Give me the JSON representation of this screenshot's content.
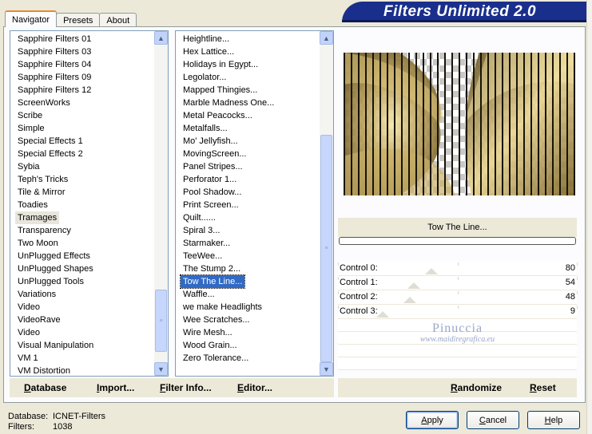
{
  "tabs": [
    {
      "label": "Navigator",
      "active": true
    },
    {
      "label": "Presets",
      "active": false
    },
    {
      "label": "About",
      "active": false
    }
  ],
  "banner": {
    "title": "Filters Unlimited 2.0"
  },
  "categories": {
    "items": [
      "Sapphire Filters 01",
      "Sapphire Filters 03",
      "Sapphire Filters 04",
      "Sapphire Filters 09",
      "Sapphire Filters 12",
      "ScreenWorks",
      "Scribe",
      "Simple",
      "Special Effects 1",
      "Special Effects 2",
      "Sybia",
      "Teph's Tricks",
      "Tile & Mirror",
      "Toadies",
      "Tramages",
      "Transparency",
      "Two Moon",
      "UnPlugged Effects",
      "UnPlugged Shapes",
      "UnPlugged Tools",
      "Variations",
      "Video",
      "VideoRave",
      "Video",
      "Visual Manipulation",
      "VM 1",
      "VM Distortion"
    ],
    "selected": "Tramages"
  },
  "filters": {
    "items": [
      "Heightline...",
      "Hex Lattice...",
      "Holidays in Egypt...",
      "Legolator...",
      "Mapped Thingies...",
      "Marble Madness One...",
      "Metal Peacocks...",
      "Metalfalls...",
      "Mo' Jellyfish...",
      "MovingScreen...",
      "Panel Stripes...",
      "Perforator 1...",
      "Pool Shadow...",
      "Print Screen...",
      "Quilt......",
      "Spiral 3...",
      "Starmaker...",
      "TeeWee...",
      "The Stump 2...",
      "Tow The Line...",
      "Waffle...",
      "we make Headlights",
      "Wee Scratches...",
      "Wire Mesh...",
      "Wood Grain...",
      "Zero Tolerance..."
    ],
    "selected": "Tow The Line..."
  },
  "preview": {
    "filter_name": "Tow The Line..."
  },
  "controls": [
    {
      "label": "Control 0:",
      "value": 80
    },
    {
      "label": "Control 1:",
      "value": 54
    },
    {
      "label": "Control 2:",
      "value": 48
    },
    {
      "label": "Control 3:",
      "value": 9
    }
  ],
  "watermark": {
    "line1": "Pinuccia",
    "line2": "www.maidiregrafica.eu"
  },
  "left_buttons": {
    "database": {
      "first": "D",
      "rest": "atabase"
    },
    "import": {
      "first": "I",
      "rest": "mport..."
    },
    "filter_info": {
      "first": "F",
      "rest": "ilter Info..."
    },
    "editor": {
      "first": "E",
      "rest": "ditor..."
    }
  },
  "right_buttons": {
    "randomize": {
      "first": "R",
      "rest": "andomize"
    },
    "reset": {
      "first": "R",
      "rest": "eset"
    }
  },
  "status": {
    "database_label": "Database:",
    "database_value": "ICNET-Filters",
    "filters_label": "Filters:",
    "filters_value": "1038"
  },
  "dialog_buttons": {
    "apply": {
      "first": "A",
      "rest": "pply"
    },
    "cancel": {
      "first": "C",
      "rest": "ancel"
    },
    "help": {
      "first": "H",
      "rest": "elp"
    }
  },
  "colors": {
    "banner": "#1a2f8c",
    "selection": "#316ac5"
  },
  "icons": {
    "scroll_up": "chevron-up-icon",
    "scroll_down": "chevron-down-icon"
  }
}
